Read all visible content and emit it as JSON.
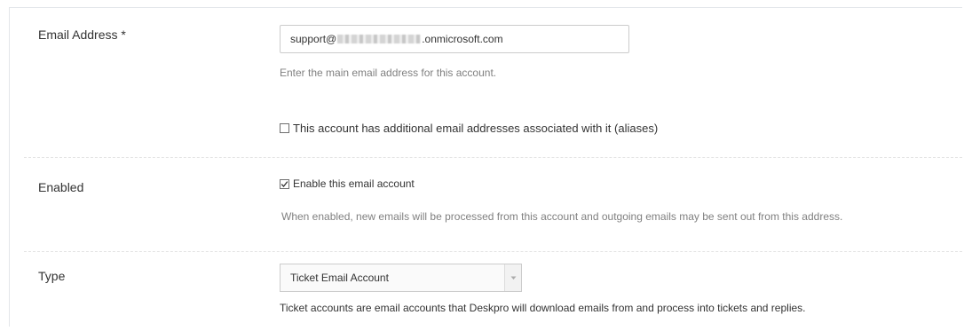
{
  "email_section": {
    "label": "Email Address *",
    "input_value_prefix": "support@",
    "input_value_suffix": ".onmicrosoft.com",
    "help_text": "Enter the main email address for this account.",
    "aliases_checkbox_label": "This account has additional email addresses associated with it (aliases)",
    "aliases_checked": false
  },
  "enabled_section": {
    "label": "Enabled",
    "checkbox_label": "Enable this email account",
    "checked": true,
    "help_text": "When enabled, new emails will be processed from this account and outgoing emails may be sent out from this address."
  },
  "type_section": {
    "label": "Type",
    "selected_value": "Ticket Email Account",
    "help_text": "Ticket accounts are email accounts that Deskpro will download emails from and process into tickets and replies."
  }
}
